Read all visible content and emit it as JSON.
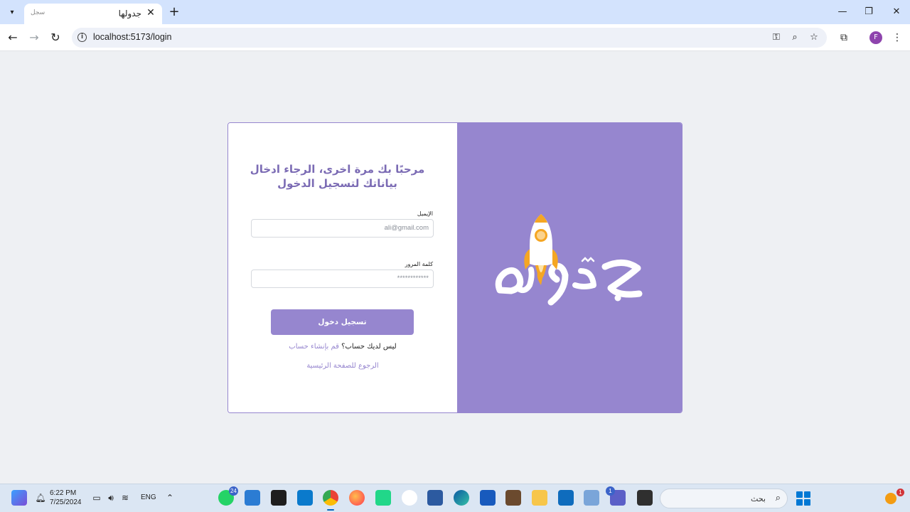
{
  "browser": {
    "tab_title": "جدولها",
    "tab_favicon": "سجل",
    "url": "localhost:5173/login",
    "profile_initial": "F"
  },
  "login": {
    "heading": "مرحبًا بك مرة اخرى، الرجاء ادخال بياناتك لتسجيل الدخول",
    "email_label": "الإيميل",
    "email_placeholder": "ali@gmail.com",
    "password_label": "كلمة المرور",
    "password_placeholder": "************",
    "submit_label": "تسجيل دخول",
    "no_account_text": "ليس لديك حساب؟",
    "signup_link": "قم بإنشاء حساب",
    "home_link": "الرجوع للصفحة الرئيسية"
  },
  "brand": {
    "logo_text": "جدولها",
    "colors": {
      "primary": "#9686cf",
      "heading": "#7b6bb4",
      "rocket_flame": "#f5a623"
    }
  },
  "taskbar": {
    "time": "6:22 PM",
    "date": "7/25/2024",
    "language": "ENG",
    "search_placeholder": "بحث",
    "whatsapp_badge": "24",
    "teams_badge": "1",
    "notification_badge": "1"
  }
}
